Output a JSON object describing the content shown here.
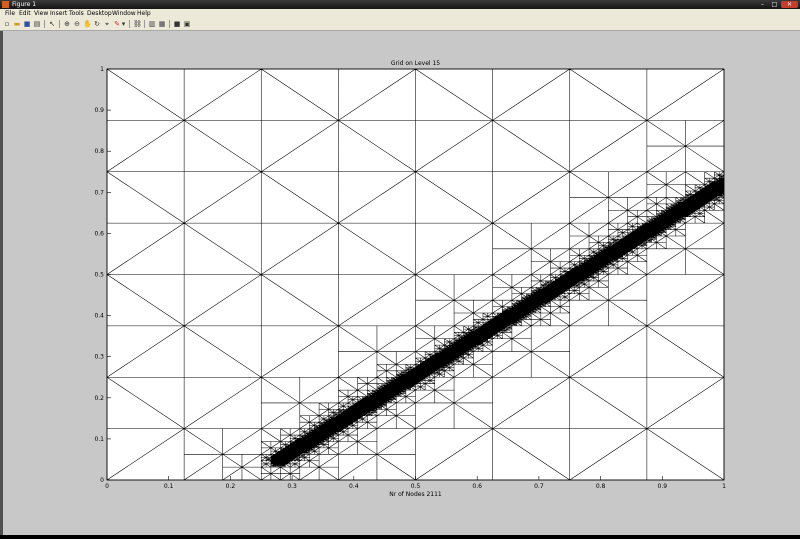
{
  "window": {
    "title": "Figure 1",
    "min_glyph": "–",
    "max_glyph": "□",
    "close_glyph": "✕"
  },
  "menu": [
    "File",
    "Edit",
    "View",
    "Insert",
    "Tools",
    "Desktop",
    "Window",
    "Help"
  ],
  "toolbar_icons": [
    "new-figure-icon",
    "open-file-icon",
    "save-icon",
    "print-icon",
    "edit-plot-icon",
    "zoom-in-icon",
    "zoom-out-icon",
    "pan-icon",
    "rotate-3d-icon",
    "data-cursor-icon",
    "brush-icon",
    "link-plot-icon",
    "colorbar-icon",
    "legend-icon",
    "hide-plot-tools-icon",
    "show-plot-tools-icon"
  ],
  "chart_data": {
    "type": "mesh",
    "title": "Grid on Level 15",
    "xlabel": "Nr of Nodes 2111",
    "ylabel": "",
    "xlim": [
      0,
      1
    ],
    "ylim": [
      0,
      1
    ],
    "xticks": [
      "0",
      "0.1",
      "0.2",
      "0.3",
      "0.4",
      "0.5",
      "0.6",
      "0.7",
      "0.8",
      "0.9",
      "1"
    ],
    "yticks": [
      "0",
      "0.1",
      "0.2",
      "0.3",
      "0.4",
      "0.5",
      "0.6",
      "0.7",
      "0.8",
      "0.9",
      "1"
    ],
    "refinement_line": {
      "from": [
        0.28,
        0.05
      ],
      "to": [
        1.0,
        0.72
      ]
    },
    "line_color": "#000000",
    "background": "#ffffff"
  }
}
